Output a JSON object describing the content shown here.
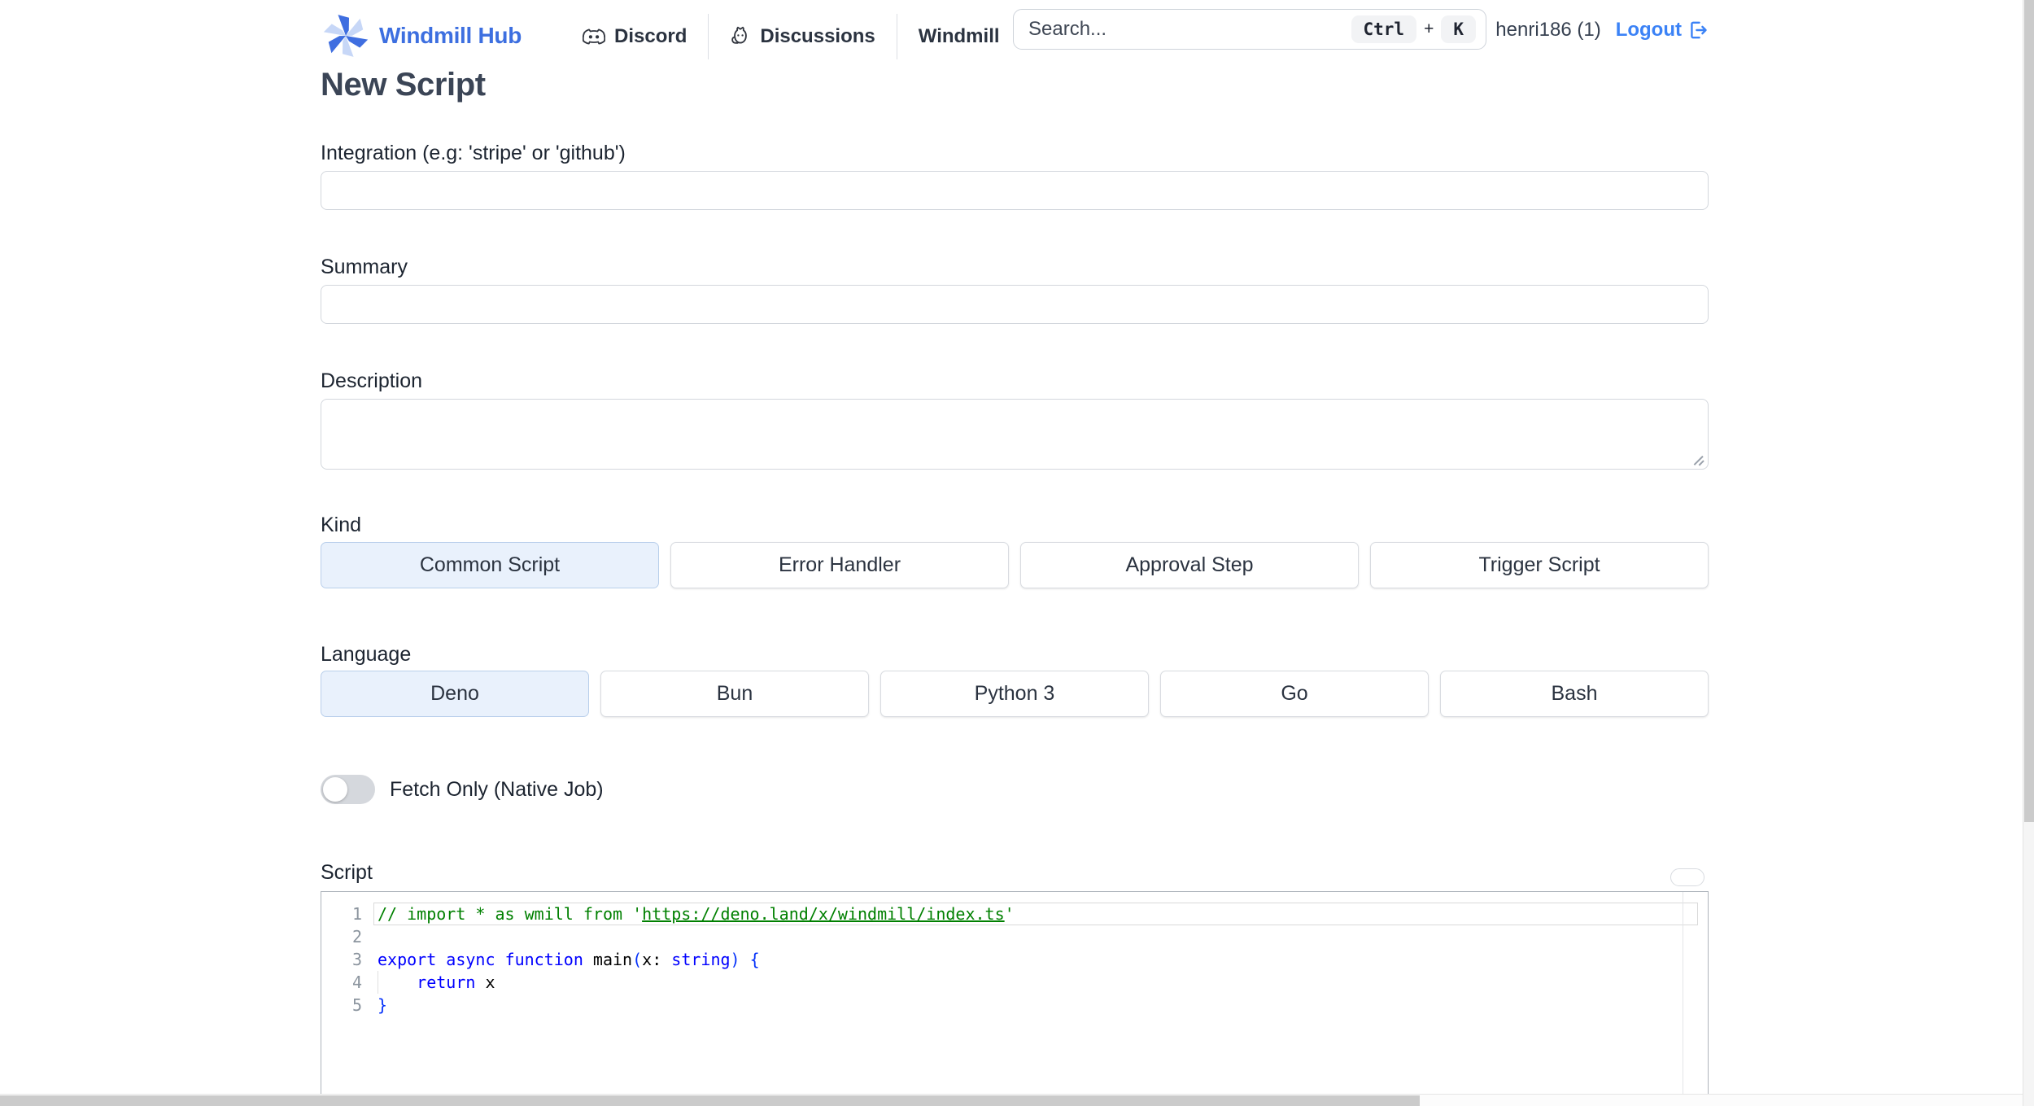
{
  "header": {
    "brand": "Windmill Hub",
    "nav": {
      "discord": "Discord",
      "discussions": "Discussions",
      "windmill": "Windmill"
    },
    "search": {
      "placeholder": "Search...",
      "kbd_ctrl": "Ctrl",
      "kbd_plus": "+",
      "kbd_k": "K"
    },
    "user": "henri186 (1)",
    "logout": "Logout"
  },
  "page": {
    "title": "New Script"
  },
  "form": {
    "integration": {
      "label": "Integration (e.g: 'stripe' or 'github')",
      "value": ""
    },
    "summary": {
      "label": "Summary",
      "value": ""
    },
    "description": {
      "label": "Description",
      "value": ""
    },
    "kind": {
      "label": "Kind",
      "options": [
        {
          "label": "Common Script",
          "selected": true
        },
        {
          "label": "Error Handler",
          "selected": false
        },
        {
          "label": "Approval Step",
          "selected": false
        },
        {
          "label": "Trigger Script",
          "selected": false
        }
      ]
    },
    "language": {
      "label": "Language",
      "options": [
        {
          "label": "Deno",
          "selected": true
        },
        {
          "label": "Bun",
          "selected": false
        },
        {
          "label": "Python 3",
          "selected": false
        },
        {
          "label": "Go",
          "selected": false
        },
        {
          "label": "Bash",
          "selected": false
        }
      ]
    },
    "fetch_only": {
      "label": "Fetch Only (Native Job)",
      "enabled": false
    },
    "script": {
      "label": "Script"
    }
  },
  "editor": {
    "lines": [
      {
        "n": 1,
        "current": true,
        "tokens": [
          [
            "comment",
            "// import * as wmill from '"
          ],
          [
            "comment-link",
            "https://deno.land/x/windmill/index.ts"
          ],
          [
            "comment",
            "'"
          ]
        ]
      },
      {
        "n": 2,
        "tokens": []
      },
      {
        "n": 3,
        "tokens": [
          [
            "keyword",
            "export"
          ],
          [
            "plain",
            " "
          ],
          [
            "keyword",
            "async"
          ],
          [
            "plain",
            " "
          ],
          [
            "keyword",
            "function"
          ],
          [
            "plain",
            " main"
          ],
          [
            "bracket",
            "("
          ],
          [
            "plain",
            "x: "
          ],
          [
            "keyword",
            "string"
          ],
          [
            "bracket",
            ")"
          ],
          [
            "plain",
            " "
          ],
          [
            "bracket",
            "{"
          ]
        ]
      },
      {
        "n": 4,
        "guide": true,
        "tokens": [
          [
            "plain",
            "    "
          ],
          [
            "keyword",
            "return"
          ],
          [
            "plain",
            " x"
          ]
        ]
      },
      {
        "n": 5,
        "tokens": [
          [
            "bracket",
            "}"
          ]
        ]
      }
    ]
  },
  "colors": {
    "brand_blue": "#3d6fe0",
    "link_blue": "#3b82f6",
    "selected_bg": "#e9f1fc",
    "selected_border": "#b9cfeb",
    "logo_dark_blade": "#3f6ee0",
    "logo_light_blade": "#c7d7f7",
    "code_comment": "#008000",
    "code_keyword": "#0000ff",
    "code_bracket": "#0431fa"
  }
}
